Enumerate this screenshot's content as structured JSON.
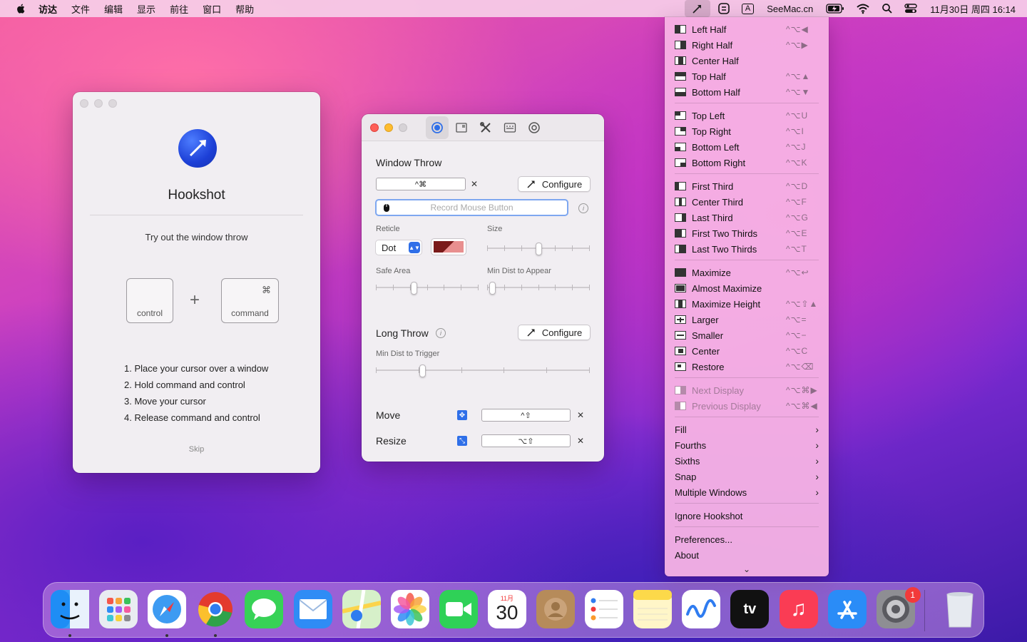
{
  "menubar": {
    "app_menus": [
      "访达",
      "文件",
      "编辑",
      "显示",
      "前往",
      "窗口",
      "帮助"
    ],
    "site": "SeeMac.cn",
    "datetime": "11月30日 周四 16:14",
    "input_source": "A"
  },
  "onboarding": {
    "title": "Hookshot",
    "subtitle": "Try out the window throw",
    "key_control": "control",
    "key_command": "command",
    "key_command_symbol": "⌘",
    "plus": "+",
    "steps": [
      "1. Place your cursor over a window",
      "2. Hold command and control",
      "3. Move your cursor",
      "4. Release command and control"
    ],
    "skip": "Skip"
  },
  "prefs": {
    "window_throw": {
      "title": "Window Throw",
      "shortcut": "^⌘",
      "configure": "Configure",
      "record_placeholder": "Record Mouse Button",
      "reticle_label": "Reticle",
      "reticle_value": "Dot",
      "size_label": "Size",
      "size_value": 0.5,
      "safe_area_label": "Safe Area",
      "safe_area_value": 0.36,
      "min_dist_label": "Min Dist to Appear",
      "min_dist_value": 0.02
    },
    "long_throw": {
      "title": "Long Throw",
      "configure": "Configure",
      "trigger_label": "Min Dist to Trigger",
      "trigger_value": 0.21
    },
    "move": {
      "label": "Move",
      "shortcut": "^⇧"
    },
    "resize": {
      "label": "Resize",
      "shortcut": "⌥⇧"
    },
    "clear": "✕",
    "info": "i"
  },
  "menu": {
    "groups": [
      [
        {
          "label": "Left Half",
          "shortcut": "^⌥◀",
          "glyph": "left-half"
        },
        {
          "label": "Right Half",
          "shortcut": "^⌥▶",
          "glyph": "right-half"
        },
        {
          "label": "Center Half",
          "shortcut": "",
          "glyph": "center-half"
        },
        {
          "label": "Top Half",
          "shortcut": "^⌥▲",
          "glyph": "top-half"
        },
        {
          "label": "Bottom Half",
          "shortcut": "^⌥▼",
          "glyph": "bottom-half"
        }
      ],
      [
        {
          "label": "Top Left",
          "shortcut": "^⌥U",
          "glyph": "top-left"
        },
        {
          "label": "Top Right",
          "shortcut": "^⌥I",
          "glyph": "top-right"
        },
        {
          "label": "Bottom Left",
          "shortcut": "^⌥J",
          "glyph": "bottom-left"
        },
        {
          "label": "Bottom Right",
          "shortcut": "^⌥K",
          "glyph": "bottom-right"
        }
      ],
      [
        {
          "label": "First Third",
          "shortcut": "^⌥D",
          "glyph": "first-third"
        },
        {
          "label": "Center Third",
          "shortcut": "^⌥F",
          "glyph": "center-third"
        },
        {
          "label": "Last Third",
          "shortcut": "^⌥G",
          "glyph": "last-third"
        },
        {
          "label": "First Two Thirds",
          "shortcut": "^⌥E",
          "glyph": "first-two-thirds"
        },
        {
          "label": "Last Two Thirds",
          "shortcut": "^⌥T",
          "glyph": "last-two-thirds"
        }
      ],
      [
        {
          "label": "Maximize",
          "shortcut": "^⌥↩",
          "glyph": "maximize"
        },
        {
          "label": "Almost Maximize",
          "shortcut": "",
          "glyph": "almost-maximize"
        },
        {
          "label": "Maximize Height",
          "shortcut": "^⌥⇧▲",
          "glyph": "maximize-height"
        },
        {
          "label": "Larger",
          "shortcut": "^⌥=",
          "glyph": "larger"
        },
        {
          "label": "Smaller",
          "shortcut": "^⌥−",
          "glyph": "smaller"
        },
        {
          "label": "Center",
          "shortcut": "^⌥C",
          "glyph": "center"
        },
        {
          "label": "Restore",
          "shortcut": "^⌥⌫",
          "glyph": "restore"
        }
      ],
      [
        {
          "label": "Next Display",
          "shortcut": "^⌥⌘▶",
          "glyph": "next-display",
          "disabled": true
        },
        {
          "label": "Previous Display",
          "shortcut": "^⌥⌘◀",
          "glyph": "previous-display",
          "disabled": true
        }
      ],
      [
        {
          "label": "Fill",
          "submenu": true
        },
        {
          "label": "Fourths",
          "submenu": true
        },
        {
          "label": "Sixths",
          "submenu": true
        },
        {
          "label": "Snap",
          "submenu": true
        },
        {
          "label": "Multiple Windows",
          "submenu": true
        }
      ],
      [
        {
          "label": "Ignore Hookshot"
        }
      ],
      [
        {
          "label": "Preferences..."
        },
        {
          "label": "About"
        }
      ]
    ],
    "more_indicator": "⌄"
  },
  "dock": {
    "items": [
      {
        "name": "finder",
        "color": "#3aa0f5",
        "running": true
      },
      {
        "name": "launchpad",
        "color": "#e9ecf1"
      },
      {
        "name": "safari",
        "color": "#ffffff",
        "running": true
      },
      {
        "name": "chrome",
        "color": "#ffffff",
        "running": true
      },
      {
        "name": "messages",
        "color": "#37d256"
      },
      {
        "name": "mail",
        "color": "#2f8cf5"
      },
      {
        "name": "maps",
        "color": "#6fd36a"
      },
      {
        "name": "photos",
        "color": "#ffffff"
      },
      {
        "name": "facetime",
        "color": "#2fd157"
      },
      {
        "name": "calendar",
        "color": "#ffffff",
        "month": "11月",
        "day": "30"
      },
      {
        "name": "contacts",
        "color": "#b68b5a"
      },
      {
        "name": "reminders",
        "color": "#ffffff"
      },
      {
        "name": "notes",
        "color": "#fff6c8"
      },
      {
        "name": "freeform",
        "color": "#ffffff"
      },
      {
        "name": "apple-tv",
        "color": "#111111",
        "label": "tv"
      },
      {
        "name": "music",
        "color": "#fa3c54"
      },
      {
        "name": "app-store",
        "color": "#2a8cf7"
      },
      {
        "name": "system-settings",
        "color": "#8e8e93",
        "badge": "1"
      },
      {
        "name": "trash",
        "color": "#e8ecf2"
      }
    ]
  }
}
